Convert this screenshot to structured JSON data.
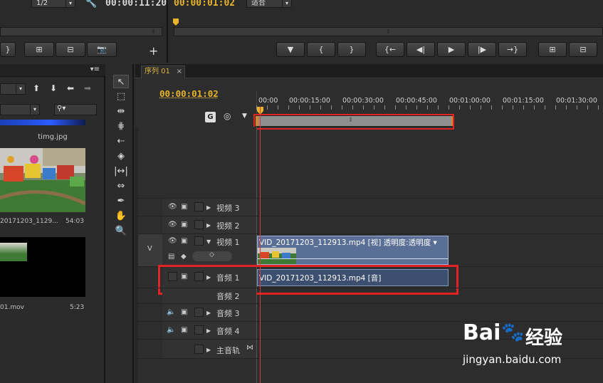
{
  "source_monitor": {
    "zoom": "1/2",
    "timecode": "00:00:11:20"
  },
  "program_monitor": {
    "timecode": "00:00:01:02",
    "fit": "适合"
  },
  "project": {
    "file1_name": "timg.jpg",
    "file2_name": "20171203_1129...",
    "file2_duration": "54:03",
    "file3_name": "01.mov",
    "file3_duration": "5:23"
  },
  "timeline": {
    "tab": "序列 01",
    "tab_close": "×",
    "timecode": "00:00:01:02",
    "ruler": [
      "00:00",
      "00:00:15:00",
      "00:00:30:00",
      "00:00:45:00",
      "00:01:00:00",
      "00:01:15:00",
      "00:01:30:00"
    ],
    "v_label": "V",
    "tracks": {
      "video3": "视频 3",
      "video2": "视频 2",
      "video1": "视频 1",
      "audio1": "音频 1",
      "audio2": "音频 2",
      "audio3": "音频 3",
      "audio4": "音频 4",
      "master": "主音轨"
    },
    "video_clip": "VID_20171203_112913.mp4  [视]  透明度:透明度 ▾",
    "audio_clip": "VID_20171203_112913.mp4  [音]"
  },
  "watermark": {
    "brand": "Bai",
    "brand2": "经验",
    "url": "jingyan.baidu.com"
  },
  "colors": {
    "accent_timecode": "#e8b52a",
    "highlight_box": "#e02424",
    "video_clip": "#5a6f95",
    "audio_clip": "#3d4f6e"
  }
}
